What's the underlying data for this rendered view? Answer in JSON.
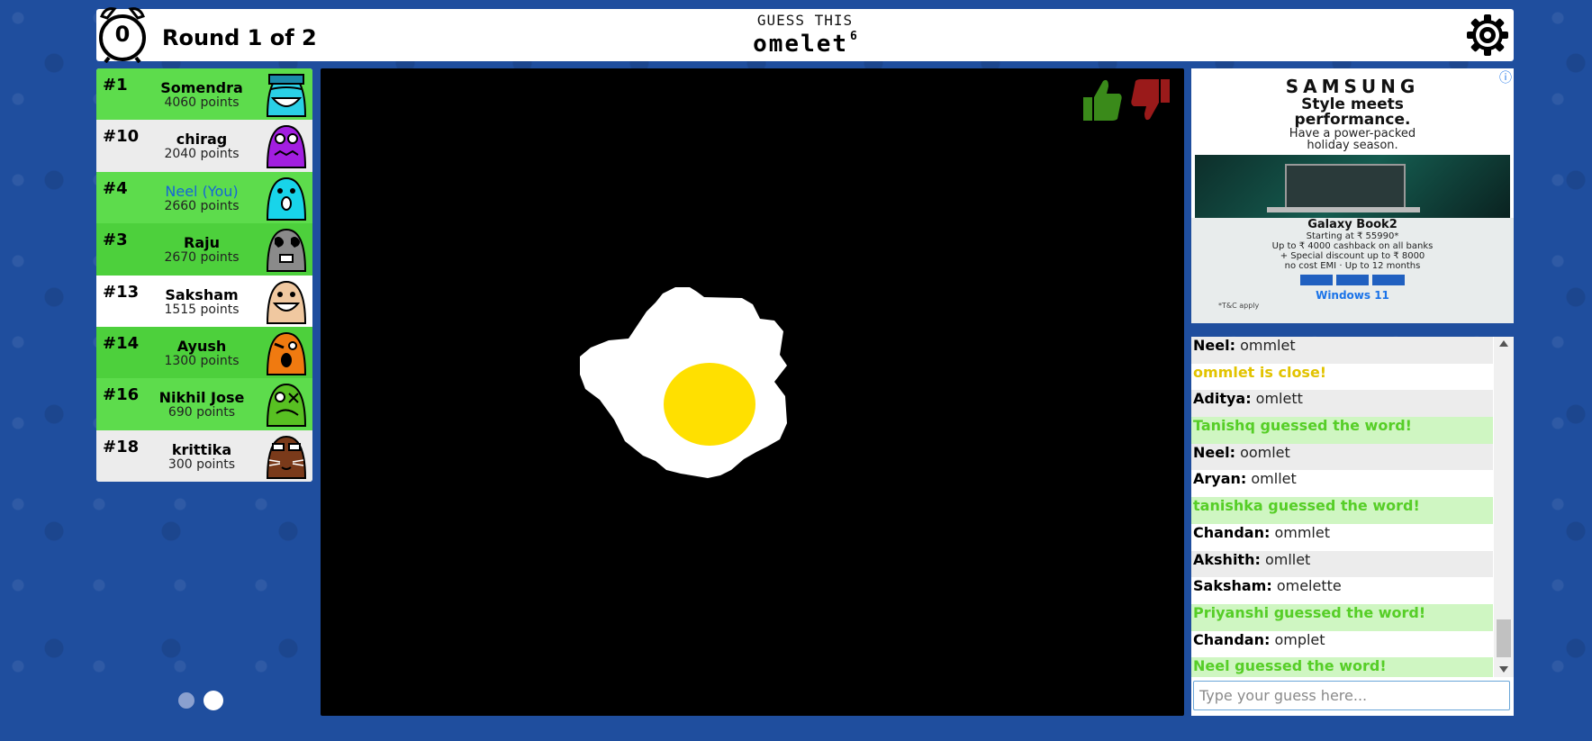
{
  "header": {
    "timer": "0",
    "round_text": "Round 1 of 2",
    "guess_label": "GUESS THIS",
    "word": "omelet",
    "word_length": "6"
  },
  "players": [
    {
      "rank": "#1",
      "name": "Somendra",
      "points": "4060 points",
      "avatar_color": "#2ad0e6"
    },
    {
      "rank": "#10",
      "name": "chirag",
      "points": "2040 points",
      "avatar_color": "#a21ee0"
    },
    {
      "rank": "#4",
      "name": "Neel (You)",
      "points": "2660 points",
      "avatar_color": "#18d4ea"
    },
    {
      "rank": "#3",
      "name": "Raju",
      "points": "2670 points",
      "avatar_color": "#8a8a8a"
    },
    {
      "rank": "#13",
      "name": "Saksham",
      "points": "1515 points",
      "avatar_color": "#f0c8a0"
    },
    {
      "rank": "#14",
      "name": "Ayush",
      "points": "1300 points",
      "avatar_color": "#f07a10"
    },
    {
      "rank": "#16",
      "name": "Nikhil Jose",
      "points": "690 points",
      "avatar_color": "#58c022"
    },
    {
      "rank": "#18",
      "name": "krittika",
      "points": "300 points",
      "avatar_color": "#7a3a1a"
    }
  ],
  "ad": {
    "info": "ⓘ",
    "brand": "SAMSUNG",
    "headline1": "Style meets",
    "headline2": "performance.",
    "sub1": "Have a power-packed",
    "sub2": "holiday season.",
    "model": "Galaxy Book2",
    "price1": "Starting at",
    "price2": "₹ 55990*",
    "offer1": "Up to ₹ 4000",
    "offer2": "cashback",
    "offer3": "on all banks",
    "offer4": "+",
    "offer5": "Special discount",
    "offer6": "up to ₹ 8000",
    "offer7": "no cost EMI",
    "offer8": "Up to 12 months",
    "windows_text": "Windows 11",
    "fine": "*T&C apply"
  },
  "chat": [
    {
      "type": "g",
      "who": "Neel:",
      "text": " ommlet"
    },
    {
      "type": "close",
      "who": "",
      "text": "ommlet is close!"
    },
    {
      "type": "g",
      "who": "Aditya:",
      "text": " omlett"
    },
    {
      "type": "green",
      "who": "",
      "text": "Tanishq guessed the word!"
    },
    {
      "type": "g",
      "who": "Neel:",
      "text": " oomlet"
    },
    {
      "type": "w",
      "who": "Aryan:",
      "text": " omllet"
    },
    {
      "type": "green",
      "who": "",
      "text": "tanishka guessed the word!"
    },
    {
      "type": "w",
      "who": "Chandan:",
      "text": " ommlet"
    },
    {
      "type": "g",
      "who": "Akshith:",
      "text": " omllet"
    },
    {
      "type": "w",
      "who": "Saksham:",
      "text": " omelette"
    },
    {
      "type": "green",
      "who": "",
      "text": "Priyanshi guessed the word!"
    },
    {
      "type": "w",
      "who": "Chandan:",
      "text": " omplet"
    },
    {
      "type": "green",
      "who": "",
      "text": "Neel guessed the word!"
    }
  ],
  "guess_input": {
    "placeholder": "Type your guess here...",
    "value": ""
  },
  "colors": {
    "background": "#1f4e9e",
    "player_green": "#5ddc4c",
    "chat_green": "#56ce27",
    "close_yellow": "#e2c300",
    "egg_white": "#ffffff",
    "egg_yolk": "#ffe000",
    "thumb_up": "#3a8a1a",
    "thumb_down": "#9a1a1a"
  },
  "icons": {
    "timer": "alarm-clock-icon",
    "settings": "gear-icon",
    "like": "thumbs-up-icon",
    "dislike": "thumbs-down-icon"
  }
}
